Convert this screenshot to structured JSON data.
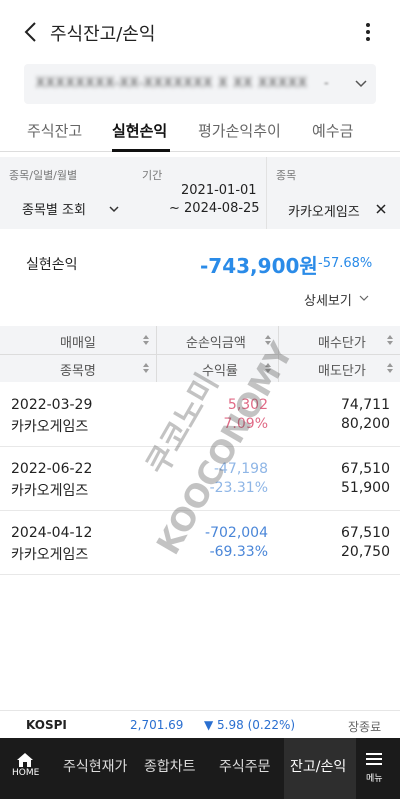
{
  "header": {
    "title": "주식잔고/손익"
  },
  "account": {
    "number": "XXXXXXXX-XX-XXXXXXX X XX XXXXX",
    "suffix": "-"
  },
  "tabs": [
    {
      "label": "주식잔고",
      "active": false
    },
    {
      "label": "실현손익",
      "active": true
    },
    {
      "label": "평가손익추이",
      "active": false
    },
    {
      "label": "예수금",
      "active": false
    }
  ],
  "filter": {
    "type_label": "종목/일별/월별",
    "type_value": "종목별 조회",
    "period_label": "기간",
    "period_start": "2021-01-01",
    "period_end": "~ 2024-08-25",
    "stock_label": "종목",
    "stock_value": "카카오게임즈"
  },
  "summary": {
    "label": "실현손익",
    "value": "-743,900원",
    "rate": "-57.68%",
    "detail": "상세보기"
  },
  "table": {
    "headers": {
      "trade_date": "매매일",
      "net_profit": "순손익금액",
      "buy_price": "매수단가",
      "stock_name": "종목명",
      "profit_rate": "수익률",
      "sell_price": "매도단가"
    },
    "rows": [
      {
        "date": "2022-03-29",
        "name": "카카오게임즈",
        "profit": "5,302",
        "rate": "7.09%",
        "buy": "74,711",
        "sell": "80,200",
        "trend": "up"
      },
      {
        "date": "2022-06-22",
        "name": "카카오게임즈",
        "profit": "-47,198",
        "rate": "-23.31%",
        "buy": "67,510",
        "sell": "51,900",
        "trend": "down"
      },
      {
        "date": "2024-04-12",
        "name": "카카오게임즈",
        "profit": "-702,004",
        "rate": "-69.33%",
        "buy": "67,510",
        "sell": "20,750",
        "trend": "down"
      }
    ]
  },
  "watermark": {
    "line1": "쿠코노미",
    "line2": "KOOCONOMY"
  },
  "ticker": {
    "name": "KOSPI",
    "value": "2,701.69",
    "change": "▼ 5.98 (0.22%)",
    "status": "장종료"
  },
  "bottom_nav": {
    "home": "HOME",
    "items": [
      "주식현재가",
      "종합차트",
      "주식주문",
      "잔고/손익"
    ],
    "menu": "메뉴"
  },
  "colors": {
    "accent_blue": "#2a8be8",
    "up_red": "#e06a86",
    "down_blue": "#8fb6e6",
    "nav_bg": "#1b1b1b"
  }
}
